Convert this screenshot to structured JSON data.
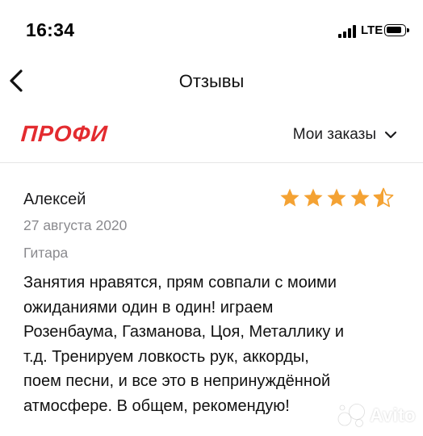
{
  "status_bar": {
    "time": "16:34",
    "network": "LTE"
  },
  "nav": {
    "title": "Отзывы"
  },
  "header": {
    "logo": "ПРОФИ",
    "orders_label": "Мои заказы"
  },
  "review": {
    "author": "Алексей",
    "date": "27 августа 2020",
    "category": "Гитара",
    "rating": 4.5,
    "rating_max": 5,
    "text": "Занятия нравятся, прям совпали с моими\nожиданиями один в один! играем\nРозенбаума, Газманова, Цоя, Металлику и\nт.д. Тренируем ловкость рук, аккорды,\nпоем песни, и все это в непринуждённой\nатмосфере. В общем, рекомендую!"
  },
  "watermark": {
    "text": "Avito"
  },
  "colors": {
    "brand": "#e32b2f",
    "star": "#f4a233",
    "muted_text": "#8a8a8e"
  }
}
